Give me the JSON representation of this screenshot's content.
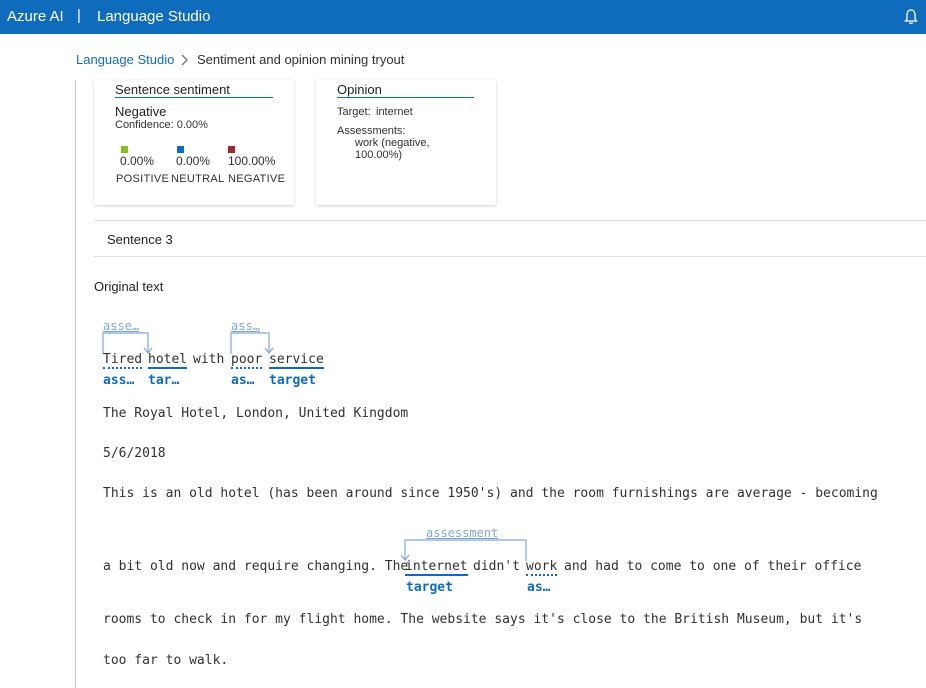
{
  "topbar": {
    "brand": "Azure AI",
    "separator": "|",
    "product": "Language Studio",
    "bell_icon": "bell-icon"
  },
  "breadcrumb": {
    "root": "Language Studio",
    "current": "Sentiment and opinion mining tryout"
  },
  "sentiment_card": {
    "title": "Sentence sentiment",
    "label": "Negative",
    "confidence": "Confidence: 0.00%",
    "scores": [
      {
        "value": "0.00%",
        "label": "POSITIVE",
        "color": "#8cbd18"
      },
      {
        "value": "0.00%",
        "label": "NEUTRAL",
        "color": "#0f6cbd"
      },
      {
        "value": "100.00%",
        "label": "NEGATIVE",
        "color": "#a4262c"
      }
    ]
  },
  "opinion_card": {
    "title": "Opinion",
    "target_key": "Target:",
    "target_value": "internet",
    "assessments_key": "Assessments:",
    "assessment_line1": "work (negative,",
    "assessment_line2": "100.00%)"
  },
  "sentence_section": {
    "label": "Sentence 3"
  },
  "original_text": {
    "label": "Original text",
    "line1": {
      "words": [
        "Tired",
        "hotel",
        "with",
        "poor",
        "service"
      ],
      "tags": [
        "ass…",
        "tar…",
        "as…",
        "target"
      ],
      "arc_labels": [
        "asse…",
        "ass…"
      ]
    },
    "line2": "The Royal Hotel, London, United Kingdom",
    "line3": "5/6/2018",
    "line4": "This is an old hotel (has been around since 1950's) and the room furnishings are average - becoming",
    "line5": {
      "before": "a bit old now and require changing. The",
      "target_word": "internet",
      "middle": "didn't",
      "assess_word": "work",
      "after": "and had to come to one of their office",
      "arc_label": "assessment",
      "target_tag": "target",
      "assess_tag": "as…"
    },
    "line6": "rooms to check in for my flight home. The website says it's close to the British Museum, but it's",
    "line7": "too far to walk."
  }
}
